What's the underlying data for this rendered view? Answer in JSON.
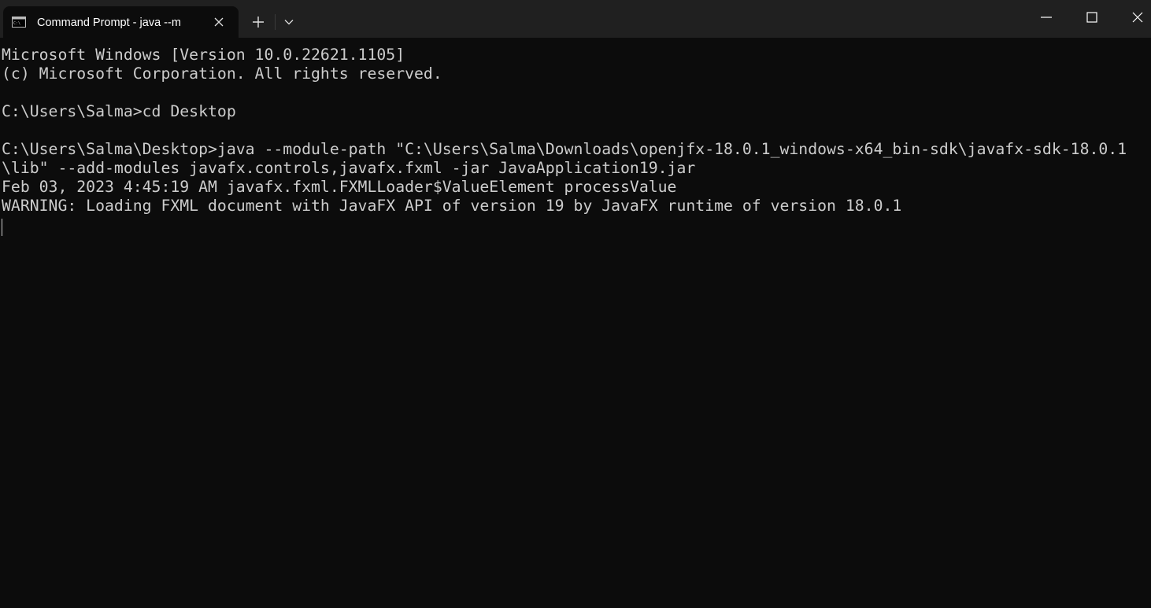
{
  "tab": {
    "title": "Command Prompt - java  --m",
    "icon": "cmd-terminal-icon"
  },
  "tabbar": {
    "new_tab_icon": "plus-icon",
    "dropdown_icon": "chevron-down-icon"
  },
  "window_controls": {
    "minimize_icon": "minimize-icon",
    "maximize_icon": "maximize-icon",
    "close_icon": "close-icon"
  },
  "console": {
    "lines": [
      "Microsoft Windows [Version 10.0.22621.1105]",
      "(c) Microsoft Corporation. All rights reserved.",
      "",
      "C:\\Users\\Salma>cd Desktop",
      "",
      "C:\\Users\\Salma\\Desktop>java --module-path \"C:\\Users\\Salma\\Downloads\\openjfx-18.0.1_windows-x64_bin-sdk\\javafx-sdk-18.0.1",
      "\\lib\" --add-modules javafx.controls,javafx.fxml -jar JavaApplication19.jar",
      "Feb 03, 2023 4:45:19 AM javafx.fxml.FXMLLoader$ValueElement processValue",
      "WARNING: Loading FXML document with JavaFX API of version 19 by JavaFX runtime of version 18.0.1"
    ]
  },
  "colors": {
    "background": "#0c0c0c",
    "tabbar": "#202020",
    "text": "#cccccc"
  }
}
